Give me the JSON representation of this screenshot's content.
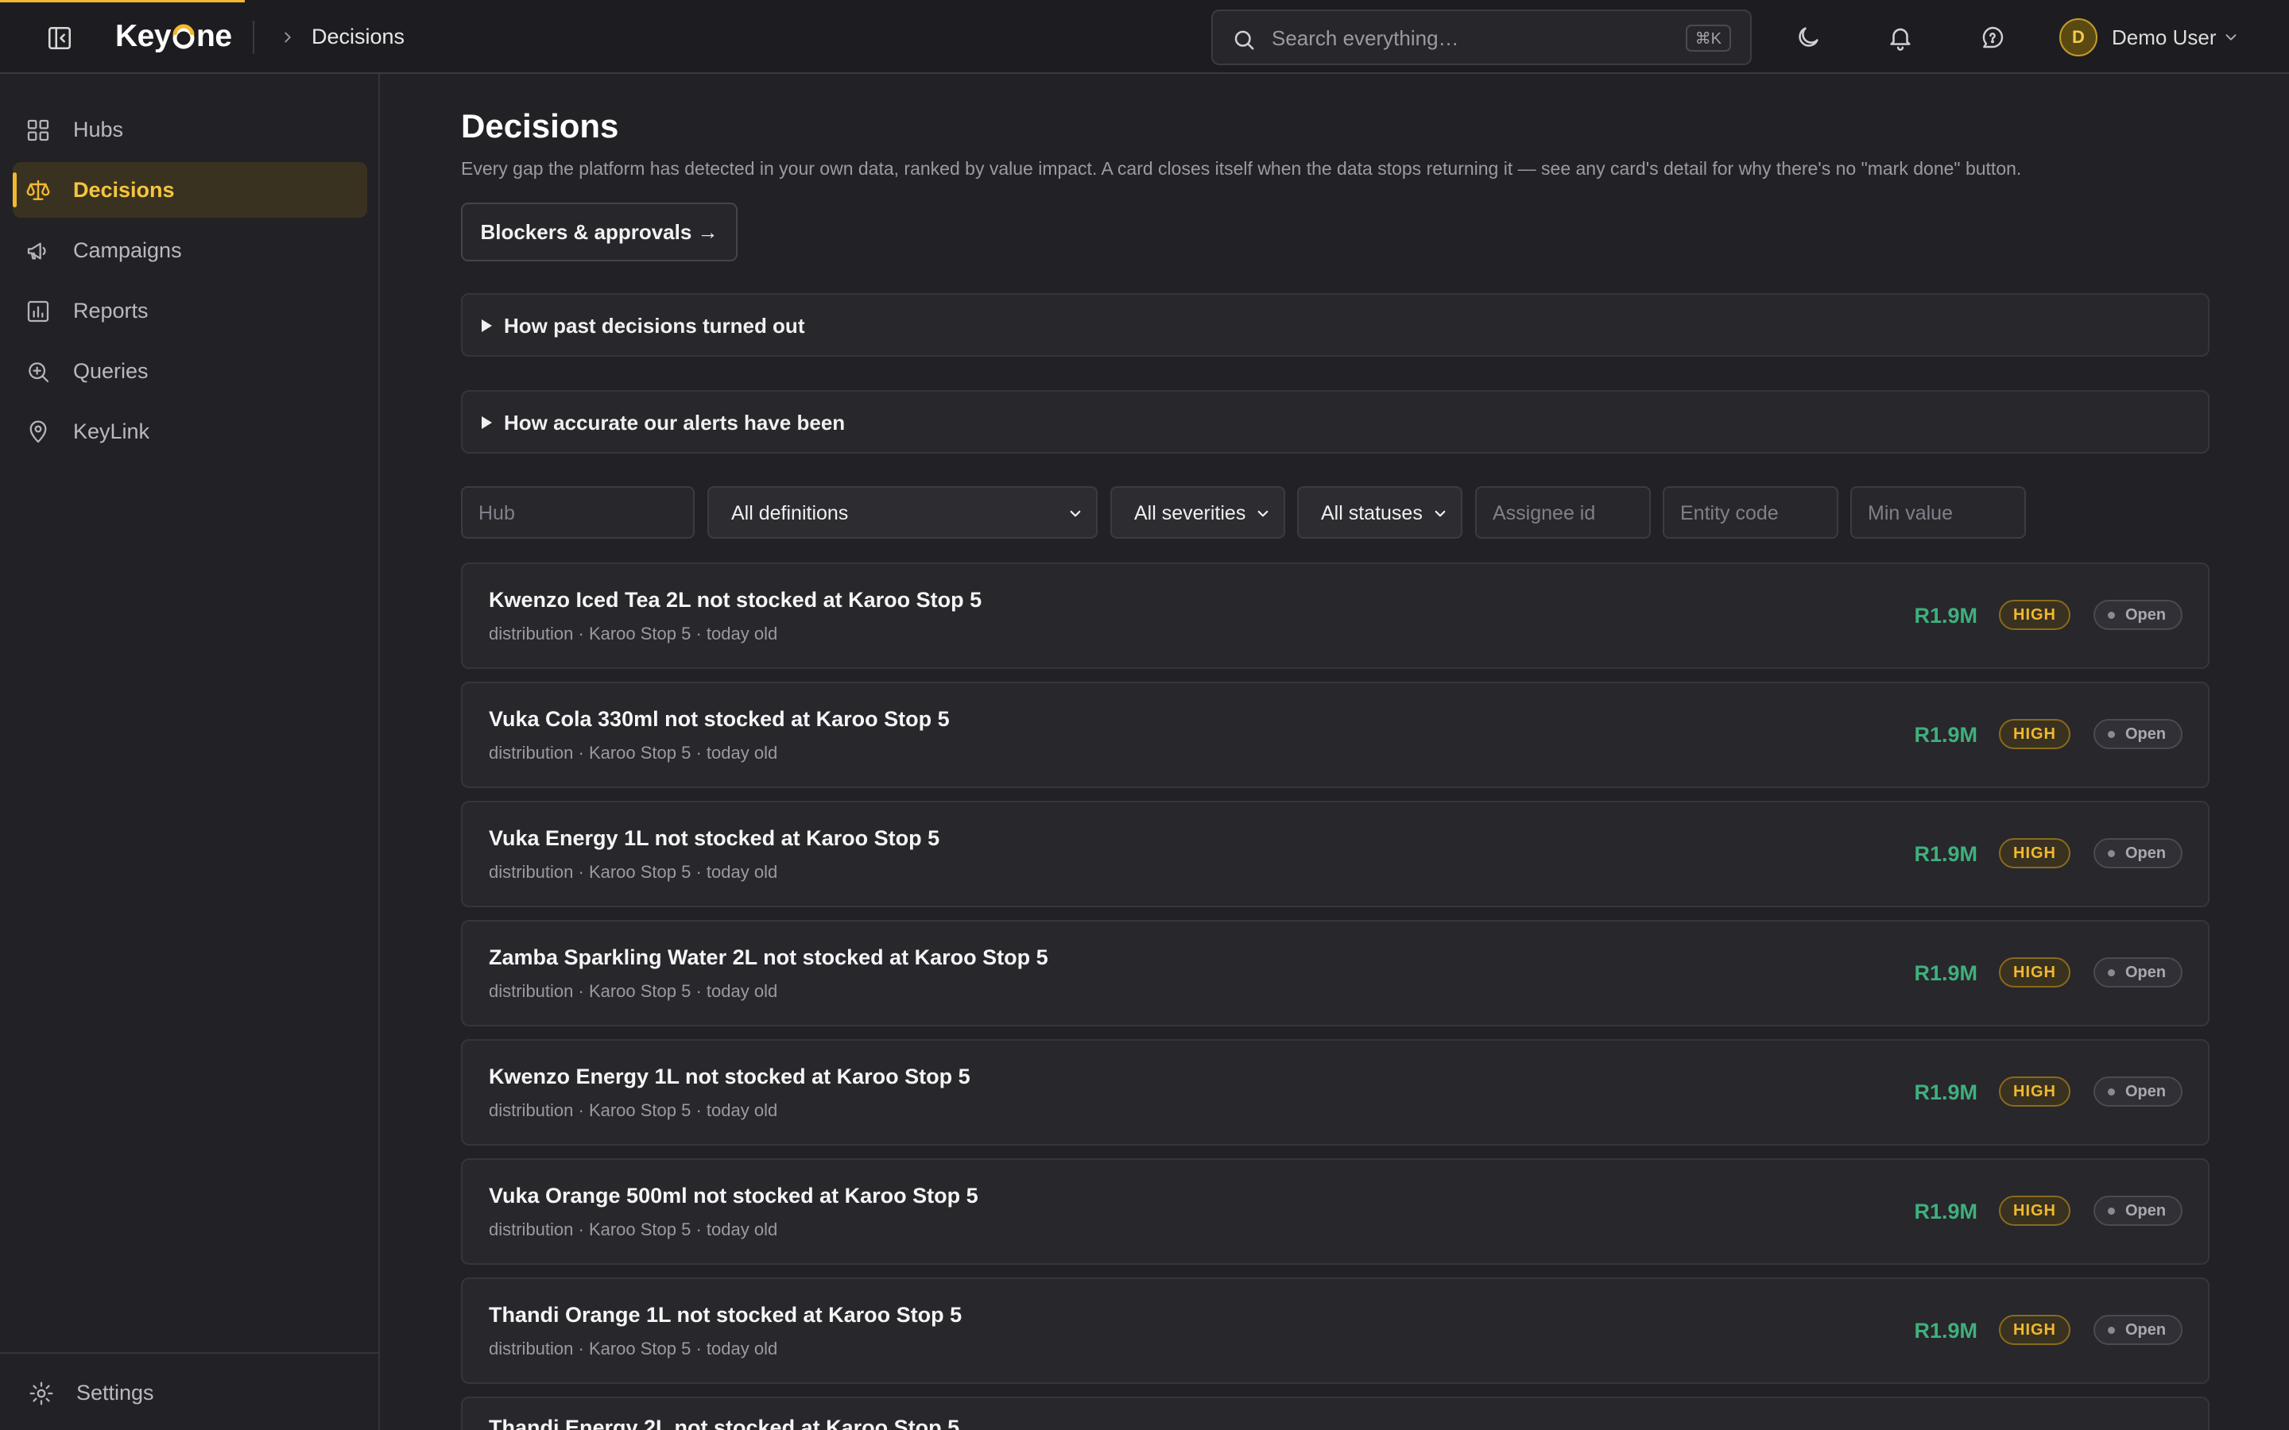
{
  "header": {
    "logo_text_before": "Key",
    "logo_text_after": "ne",
    "breadcrumb": "Decisions",
    "search_placeholder": "Search everything…",
    "search_shortcut": "⌘K",
    "user_initial": "D",
    "user_name": "Demo User"
  },
  "sidebar": {
    "items": [
      {
        "label": "Hubs",
        "icon": "grid-icon"
      },
      {
        "label": "Decisions",
        "icon": "scale-icon",
        "active": true
      },
      {
        "label": "Campaigns",
        "icon": "megaphone-icon"
      },
      {
        "label": "Reports",
        "icon": "bar-chart-icon"
      },
      {
        "label": "Queries",
        "icon": "search-plus-icon"
      },
      {
        "label": "KeyLink",
        "icon": "map-pin-icon"
      }
    ],
    "settings_label": "Settings"
  },
  "main": {
    "title": "Decisions",
    "description": "Every gap the platform has detected in your own data, ranked by value impact. A card closes itself when the data stops returning it — see any card's detail for why there's no \"mark done\" button.",
    "blockers_button": "Blockers & approvals →",
    "accordions": [
      "How past decisions turned out",
      "How accurate our alerts have been"
    ]
  },
  "filters": {
    "hub_placeholder": "Hub",
    "definitions_value": "All definitions",
    "severities_value": "All severities",
    "statuses_value": "All statuses",
    "assignee_placeholder": "Assignee id",
    "entity_placeholder": "Entity code",
    "min_value_placeholder": "Min value"
  },
  "cards": [
    {
      "title": "Kwenzo Iced Tea 2L not stocked at Karoo Stop 5",
      "subtitle": "distribution · Karoo Stop 5 · today old",
      "value": "R1.9M",
      "severity": "HIGH",
      "status": "Open"
    },
    {
      "title": "Vuka Cola 330ml not stocked at Karoo Stop 5",
      "subtitle": "distribution · Karoo Stop 5 · today old",
      "value": "R1.9M",
      "severity": "HIGH",
      "status": "Open"
    },
    {
      "title": "Vuka Energy 1L not stocked at Karoo Stop 5",
      "subtitle": "distribution · Karoo Stop 5 · today old",
      "value": "R1.9M",
      "severity": "HIGH",
      "status": "Open"
    },
    {
      "title": "Zamba Sparkling Water 2L not stocked at Karoo Stop 5",
      "subtitle": "distribution · Karoo Stop 5 · today old",
      "value": "R1.9M",
      "severity": "HIGH",
      "status": "Open"
    },
    {
      "title": "Kwenzo Energy 1L not stocked at Karoo Stop 5",
      "subtitle": "distribution · Karoo Stop 5 · today old",
      "value": "R1.9M",
      "severity": "HIGH",
      "status": "Open"
    },
    {
      "title": "Vuka Orange 500ml not stocked at Karoo Stop 5",
      "subtitle": "distribution · Karoo Stop 5 · today old",
      "value": "R1.9M",
      "severity": "HIGH",
      "status": "Open"
    },
    {
      "title": "Thandi Orange 1L not stocked at Karoo Stop 5",
      "subtitle": "distribution · Karoo Stop 5 · today old",
      "value": "R1.9M",
      "severity": "HIGH",
      "status": "Open"
    },
    {
      "title": "Thandi Energy 2L not stocked at Karoo Stop 5",
      "subtitle": "",
      "value": "",
      "severity": "",
      "status": ""
    }
  ],
  "colors": {
    "accent": "#f2b82f",
    "value_green": "#3fb07c",
    "background": "#222226"
  }
}
